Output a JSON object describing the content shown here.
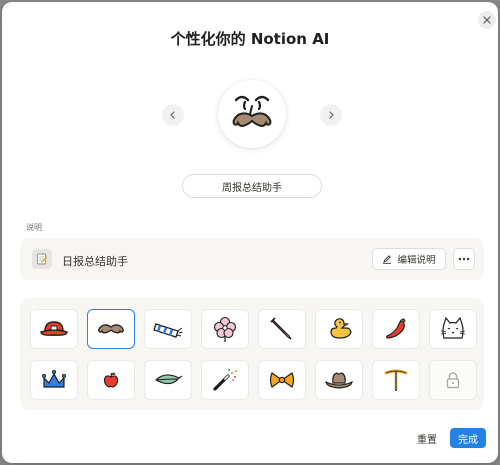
{
  "dialog": {
    "title": "个性化你的 Notion AI",
    "name_value": "周报总结助手",
    "description_label": "说明",
    "description_text": "日报总结助手",
    "edit_label": "编辑说明",
    "reset_label": "重置",
    "done_label": "完成"
  },
  "avatars": [
    {
      "name": "red-hat-icon"
    },
    {
      "name": "mustache-icon",
      "selected": true
    },
    {
      "name": "scarf-icon"
    },
    {
      "name": "flower-icon"
    },
    {
      "name": "pencil-icon"
    },
    {
      "name": "duck-icon"
    },
    {
      "name": "chili-pepper-icon"
    },
    {
      "name": "cat-icon"
    },
    {
      "name": "crown-icon"
    },
    {
      "name": "apple-icon"
    },
    {
      "name": "leaf-icon"
    },
    {
      "name": "magic-wand-icon"
    },
    {
      "name": "bow-tie-icon"
    },
    {
      "name": "cowboy-hat-icon"
    },
    {
      "name": "pickaxe-icon"
    },
    {
      "name": "lock-icon",
      "locked": true
    }
  ],
  "colors": {
    "accent": "#2383e2",
    "selected_border": "#2f80ed",
    "panel_bg": "#f7f6f3"
  }
}
